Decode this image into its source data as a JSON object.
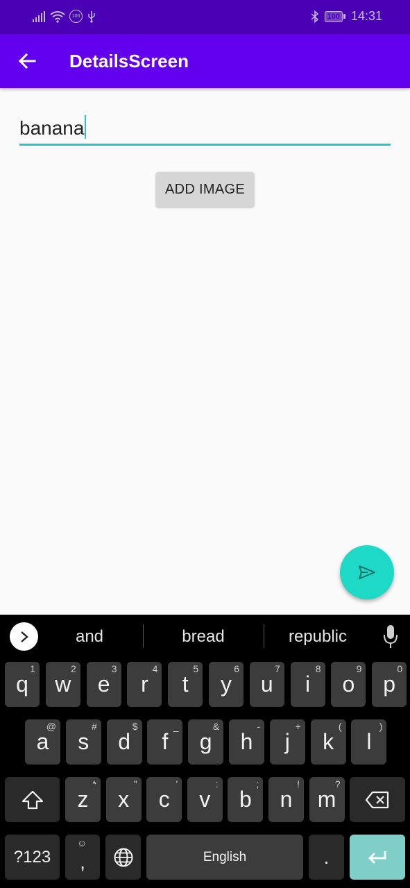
{
  "status_bar": {
    "time": "14:31",
    "battery": "100",
    "left_badge": "100"
  },
  "app_bar": {
    "title": "DetailsScreen",
    "back_icon": "arrow-back-icon"
  },
  "form": {
    "text_value": "banana",
    "add_image_label": "ADD IMAGE"
  },
  "fab": {
    "icon": "send-icon"
  },
  "keyboard": {
    "suggestions": [
      "and",
      "bread",
      "republic"
    ],
    "row1": [
      {
        "k": "q",
        "s": "1"
      },
      {
        "k": "w",
        "s": "2"
      },
      {
        "k": "e",
        "s": "3"
      },
      {
        "k": "r",
        "s": "4"
      },
      {
        "k": "t",
        "s": "5"
      },
      {
        "k": "y",
        "s": "6"
      },
      {
        "k": "u",
        "s": "7"
      },
      {
        "k": "i",
        "s": "8"
      },
      {
        "k": "o",
        "s": "9"
      },
      {
        "k": "p",
        "s": "0"
      }
    ],
    "row2": [
      {
        "k": "a",
        "s": "@"
      },
      {
        "k": "s",
        "s": "#"
      },
      {
        "k": "d",
        "s": "$"
      },
      {
        "k": "f",
        "s": "_"
      },
      {
        "k": "g",
        "s": "&"
      },
      {
        "k": "h",
        "s": "-"
      },
      {
        "k": "j",
        "s": "+"
      },
      {
        "k": "k",
        "s": "("
      },
      {
        "k": "l",
        "s": ")"
      }
    ],
    "row3": [
      {
        "k": "z",
        "s": "*"
      },
      {
        "k": "x",
        "s": "\""
      },
      {
        "k": "c",
        "s": "'"
      },
      {
        "k": "v",
        "s": ":"
      },
      {
        "k": "b",
        "s": ";"
      },
      {
        "k": "n",
        "s": "!"
      },
      {
        "k": "m",
        "s": "?"
      }
    ],
    "symbols_label": "?123",
    "comma_label": ",",
    "space_label": "English",
    "period_label": ".",
    "accent_color": "#7fcfc8"
  },
  "colors": {
    "status_bar": "#4a00b4",
    "app_bar": "#6200ee",
    "accent": "#26c6c6",
    "fab": "#1dd9c6"
  }
}
